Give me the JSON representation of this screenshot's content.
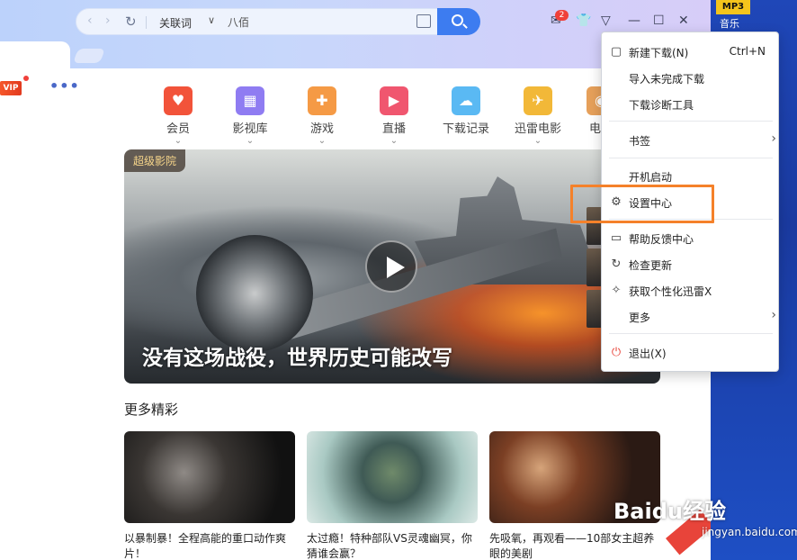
{
  "desktop": {
    "mp3_badge": "MP3",
    "mp3_label": "音乐"
  },
  "search": {
    "category": "关联词",
    "query": "八佰"
  },
  "notification_count": "2",
  "vip_badge": "VIP",
  "more_dots": "•••",
  "categories": [
    {
      "label": "会员",
      "color": "#f2533a",
      "icon": "vip-icon"
    },
    {
      "label": "影视库",
      "color": "#8f7cf2",
      "icon": "film-icon"
    },
    {
      "label": "游戏",
      "color": "#f59a45",
      "icon": "gamepad-icon"
    },
    {
      "label": "直播",
      "color": "#f0566f",
      "icon": "tv-icon"
    },
    {
      "label": "下载记录",
      "color": "#5ab9f3",
      "icon": "cloud-icon"
    },
    {
      "label": "迅雷电影",
      "color": "#f2b838",
      "icon": "bird-icon"
    },
    {
      "label": "电影",
      "color": "#e6a05a",
      "icon": "movie-icon"
    }
  ],
  "hero": {
    "tag": "超级影院",
    "caption": "没有这场战役，世界历史可能改写"
  },
  "more_section_title": "更多精彩",
  "cards": [
    {
      "text": "以暴制暴！全程高能的重口动作爽片！"
    },
    {
      "text": "太过瘾！特种部队VS灵魂幽冥，你猜谁会赢？"
    },
    {
      "text": "先吸氧，再观看——10部女主超养眼的美剧"
    }
  ],
  "watermark": {
    "brand": "Baidu经验",
    "url": "jingyan.baidu.com"
  },
  "menu": {
    "items": [
      {
        "label": "新建下载(N)",
        "shortcut": "Ctrl+N",
        "icon": "new-download-icon"
      },
      {
        "label": "导入未完成下载"
      },
      {
        "label": "下载诊断工具"
      },
      {
        "label": "书签",
        "submenu": "›"
      },
      {
        "label": "开机启动"
      },
      {
        "label": "设置中心",
        "icon": "gear-icon"
      },
      {
        "label": "帮助反馈中心",
        "icon": "feedback-icon"
      },
      {
        "label": "检查更新",
        "icon": "refresh-icon"
      },
      {
        "label": "获取个性化迅雷X",
        "icon": "magic-wand-icon"
      },
      {
        "label": "更多",
        "submenu": "›"
      },
      {
        "label": "退出(X)",
        "icon": "power-icon"
      }
    ]
  },
  "colors": {
    "accent": "#3d7cf0",
    "highlight_box": "#f5812a",
    "exit_icon": "#e8443a"
  }
}
